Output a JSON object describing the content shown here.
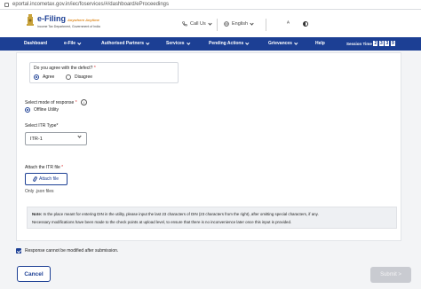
{
  "browser": {
    "url": "eportal.incometax.gov.in/iec/foservices/#/dashboard/eProceedings"
  },
  "header": {
    "logo_title": "e-Filing",
    "logo_tagline": "Anywhere Anytime",
    "logo_subtitle": "Income Tax Department, Government of India",
    "call_us": "Call Us",
    "language": "English"
  },
  "nav": {
    "items": [
      {
        "label": "Dashboard"
      },
      {
        "label": "e-File"
      },
      {
        "label": "Authorised Partners"
      },
      {
        "label": "Services"
      },
      {
        "label": "Pending Actions"
      },
      {
        "label": "Grievances"
      },
      {
        "label": "Help"
      }
    ],
    "session_label": "Session Time",
    "session_digits": [
      "2",
      "3",
      "3",
      "9"
    ]
  },
  "form": {
    "defect_question": "Do you agree with the defect?",
    "required_mark": "*",
    "agree_label": "Agree",
    "disagree_label": "Disagree",
    "mode_label": "Select mode of response",
    "mode_option": "Offline Utility",
    "itr_type_label": "Select ITR Type*",
    "itr_type_value": "ITR-1",
    "attach_label": "Attach the ITR file",
    "attach_button": "Attach file",
    "attach_hint": "Only .json files",
    "note_label": "Note:",
    "note_line1": " In the place meant for entering DIN in the utility, please input the last 23 characters of DIN (23 characters from the right), after omitting special characters, if any.",
    "note_line2": "Necessary modifications have been made to the check points at upload level, to ensure that there is no inconvenience later once this input is provided.",
    "confirm_text": "Response cannot be modified after submission.",
    "cancel_button": "Cancel",
    "submit_button": "Submit >"
  },
  "colors": {
    "brand": "#1c3f94",
    "accent": "#e08a1e"
  },
  "icons": [
    "lock-icon",
    "emblem-icon",
    "phone-icon",
    "globe-icon",
    "contrast-icon",
    "chevron-down-icon",
    "info-icon",
    "paperclip-icon",
    "checkbox-checked-icon"
  ]
}
